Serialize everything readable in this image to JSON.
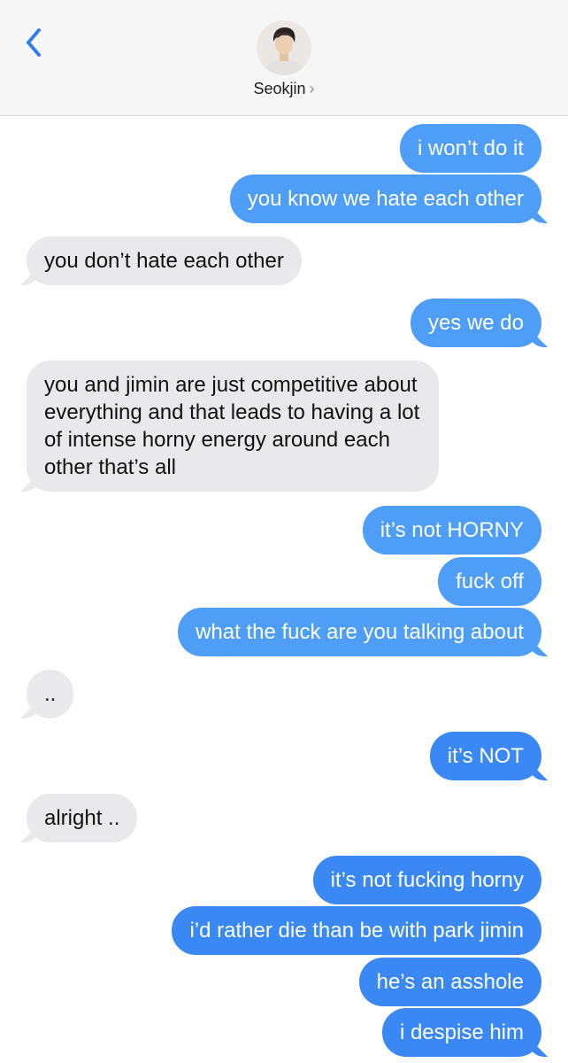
{
  "header": {
    "contact_name": "Seokjin",
    "chevron": "›",
    "back_icon": "chevron-left-icon"
  },
  "colors": {
    "sent_bubble": "#4e9ef7",
    "sent_bubble_dark": "#3a88f3",
    "received_bubble": "#e9e9eb",
    "back_arrow": "#2f7df6"
  },
  "messages": [
    {
      "from": "me",
      "text": "i won’t do it"
    },
    {
      "from": "me",
      "text": "you know we hate each other"
    },
    {
      "from": "them",
      "text": "you don’t hate each other"
    },
    {
      "from": "me",
      "text": "yes we do"
    },
    {
      "from": "them",
      "text": "you and jimin are just competitive about everything and that leads to having a lot of intense horny energy around each other that’s all"
    },
    {
      "from": "me",
      "text": "it’s not HORNY"
    },
    {
      "from": "me",
      "text": "fuck off"
    },
    {
      "from": "me",
      "text": "what the fuck are you talking about"
    },
    {
      "from": "them",
      "text": ".."
    },
    {
      "from": "me",
      "text": "it’s NOT"
    },
    {
      "from": "them",
      "text": "alright .."
    },
    {
      "from": "me",
      "text": "it’s not fucking horny"
    },
    {
      "from": "me",
      "text": "i’d rather die than be with park jimin"
    },
    {
      "from": "me",
      "text": "he’s an asshole"
    },
    {
      "from": "me",
      "text": "i despise him"
    }
  ]
}
